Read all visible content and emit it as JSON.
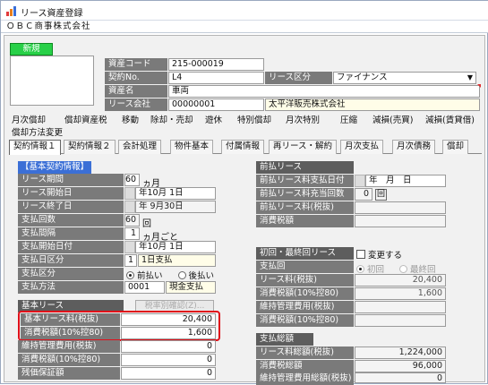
{
  "window": {
    "title": "リース資産登録",
    "company": "ＯＢＣ商事株式会社"
  },
  "header": {
    "shinki_label": "新規",
    "asset_code_label": "資産コード",
    "asset_code": "215-000019",
    "contract_no_label": "契約No.",
    "contract_no": "L4",
    "lease_type_label": "リース区分",
    "lease_type": "ファイナンス",
    "asset_name_label": "資産名",
    "asset_name": "車両",
    "lease_company_label": "リース会社",
    "lease_company_code": "00000001",
    "lease_company_name": "太平洋販売株式会社"
  },
  "tabs_row1": [
    "月次償却",
    "償却資産税",
    "移動",
    "除却・売却",
    "遊休",
    "特別償却",
    "月次特別",
    "圧縮",
    "減損(売買)",
    "減損(賃貸借)"
  ],
  "tabs_row2": [
    "償却方法変更"
  ],
  "tabs_row3": [
    "契約情報１",
    "契約情報２",
    "会計処理",
    "物件基本",
    "付属情報",
    "再リース・解約",
    "月次支払",
    "月次債務",
    "償却"
  ],
  "basic": {
    "section_title": "【基本契約情報】",
    "rows": [
      {
        "label": "リース期間",
        "value": "60",
        "suffix": "ヵ月"
      },
      {
        "label": "リース開始日",
        "value": "年10月 1日"
      },
      {
        "label": "リース終了日",
        "value": "年 9月30日"
      },
      {
        "label": "支払回数",
        "value": "60",
        "suffix": "回"
      },
      {
        "label": "支払間隔",
        "value": "1",
        "suffix": "ヵ月ごと"
      },
      {
        "label": "支払開始日付",
        "value": "年10月 1日"
      },
      {
        "label": "支払日区分",
        "value": "1",
        "extra": "1日支払"
      },
      {
        "label": "支払区分",
        "opt1": "前払い",
        "opt2": "後払い"
      },
      {
        "label": "支払方法",
        "value": "0001",
        "extra": "現金支払"
      }
    ]
  },
  "base_lease": {
    "header": "基本リース",
    "button": "税率別確認(Z)...",
    "rows": [
      {
        "label": "基本リース料(税抜)",
        "value": "20,400"
      },
      {
        "label": "消費税額(10%控80)",
        "value": "1,600"
      },
      {
        "label": "維持管理費用(税抜)",
        "value": "0"
      },
      {
        "label": "消費税額(10%控80)",
        "value": "0"
      },
      {
        "label": "残価保証額",
        "value": "0"
      }
    ]
  },
  "prepay": {
    "header": "前払リース",
    "rows": [
      {
        "label": "前払リース料支払日付",
        "value": "年　月　日"
      },
      {
        "label": "前払リース料充当回数",
        "value": "0",
        "suffix": "回"
      },
      {
        "label": "前払リース料(税抜)",
        "value": ""
      },
      {
        "label": "消費税額",
        "value": ""
      }
    ]
  },
  "initial_final": {
    "header": "初回・最終回リース",
    "change_label": "変更する",
    "rows": [
      {
        "label": "支払回",
        "opt1": "初回",
        "opt2": "最終回"
      },
      {
        "label": "リース料(税抜)",
        "value": "20,400"
      },
      {
        "label": "消費税額(10%控80)",
        "value": "1,600"
      },
      {
        "label": "維持管理費用(税抜)",
        "value": ""
      },
      {
        "label": "消費税額(10%控80)",
        "value": ""
      }
    ]
  },
  "totals": {
    "header": "支払総額",
    "rows": [
      {
        "label": "リース料総額(税抜)",
        "value": "1,224,000"
      },
      {
        "label": "消費税総額",
        "value": "96,000"
      },
      {
        "label": "維持管理費用総額(税抜)",
        "value": "0"
      }
    ]
  }
}
